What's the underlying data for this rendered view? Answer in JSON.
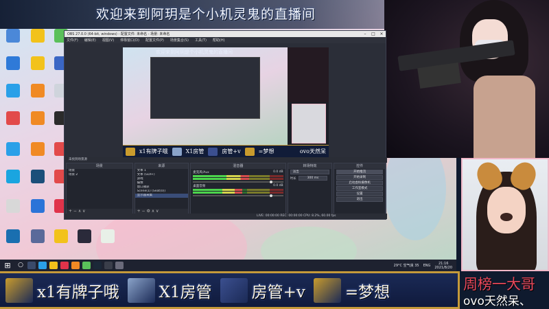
{
  "banner": {
    "title": "欢迎来到阿玥是个小机灵鬼的直播间"
  },
  "obs": {
    "title": "OBS 27.0.0 (64-bit, windows) - 配置文件: 未命名 - 场景: 未命名",
    "menu": [
      "文件(F)",
      "编辑(E)",
      "视图(V)",
      "停靠窗口(D)",
      "配置文件(P)",
      "场景集合(S)",
      "工具(T)",
      "帮助(H)"
    ],
    "info": "未找到场景源",
    "docks": {
      "scenes": {
        "title": "场景",
        "items": [
          "场景",
          "场景 2"
        ]
      },
      "sources": {
        "title": "来源",
        "items": [
          "文本 1",
          "文本 (GDI+)",
          "游戏",
          "摄像",
          "窗口捕获",
          "Scene(1) (Seat(0))",
          "显示器采集"
        ]
      },
      "mixer": {
        "title": "混音器",
        "channels": [
          {
            "name": "麦克风/Aux",
            "db": "0.0 dB",
            "level": 0.62
          },
          {
            "name": "桌面音频",
            "db": "0.0 dB",
            "level": 0.55
          }
        ]
      },
      "transitions": {
        "title": "转场特效",
        "mode": "淡出",
        "duration_label": "时长",
        "duration": "300 ms"
      },
      "controls": {
        "title": "控件",
        "buttons": [
          "开始推流",
          "开始录制",
          "启动虚拟摄像机",
          "工作室模式",
          "设置",
          "退出"
        ]
      }
    },
    "status": "LIVE: 00:00:00   REC: 00:00:00   CPU: 8.2%, 60.00 fps"
  },
  "taskbar": {
    "weather": "29°C 空气良 35",
    "lang": "ENG",
    "time": "21:16",
    "date": "2021/8/20"
  },
  "giftbar": {
    "items": [
      {
        "label": "x1有牌子哦",
        "color": "#c99b2d",
        "icon": "gold-plate-icon"
      },
      {
        "label": "X1房管",
        "color": "#8aa3c9",
        "icon": "airplane-icon"
      },
      {
        "label": "房管+v",
        "color": "#3b4f8f",
        "icon": "rocket-icon"
      },
      {
        "label": "=梦想",
        "color": "#c99b2d",
        "icon": "golden-plane-icon"
      }
    ]
  },
  "rank": {
    "label": "周榜一大哥",
    "user": "ovo天然呆、"
  },
  "webcam": {
    "nested_user": "ovo天然呆"
  },
  "preview_strip": [
    "x1有牌子哦",
    "X1房管",
    "房管+v",
    "=梦想"
  ]
}
